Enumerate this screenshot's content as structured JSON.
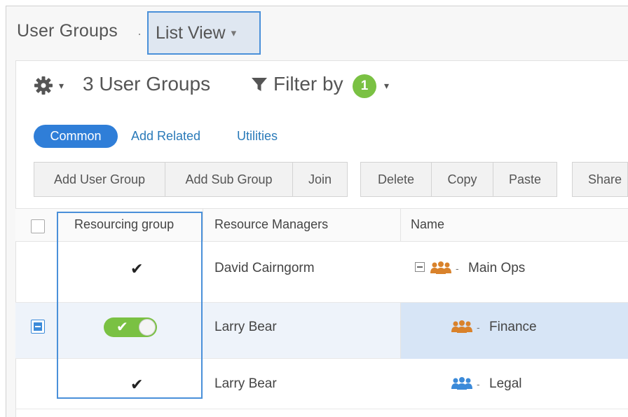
{
  "breadcrumb": {
    "title": "User Groups",
    "separator": "·"
  },
  "view_selector": {
    "label": "List View",
    "caret": "▾"
  },
  "toolbar_header": {
    "count_label": "3 User Groups",
    "filter_label": "Filter by",
    "filter_count": "1",
    "caret": "▾"
  },
  "pills": {
    "common": "Common",
    "add_related": "Add Related",
    "utilities": "Utilities"
  },
  "actions": {
    "add_user_group": "Add User Group",
    "add_sub_group": "Add Sub Group",
    "join": "Join",
    "delete": "Delete",
    "copy": "Copy",
    "paste": "Paste",
    "share": "Share"
  },
  "table": {
    "columns": [
      "Resourcing group",
      "Resource Managers",
      "Name"
    ],
    "rows": [
      {
        "resourcing": "✔",
        "manager": "David Cairngorm",
        "name": "Main Ops",
        "dash": "-",
        "icon_color": "#d9822b"
      },
      {
        "resourcing": "on",
        "manager": "Larry Bear",
        "name": "Finance",
        "dash": "-",
        "icon_color": "#d9822b"
      },
      {
        "resourcing": "✔",
        "manager": "Larry Bear",
        "name": "Legal",
        "dash": "-",
        "icon_color": "#3b8ad9"
      }
    ]
  },
  "colors": {
    "accent": "#2f7ed8",
    "badge": "#7ac143",
    "toggle_on": "#7ac143",
    "highlight": "#4a90d9"
  }
}
